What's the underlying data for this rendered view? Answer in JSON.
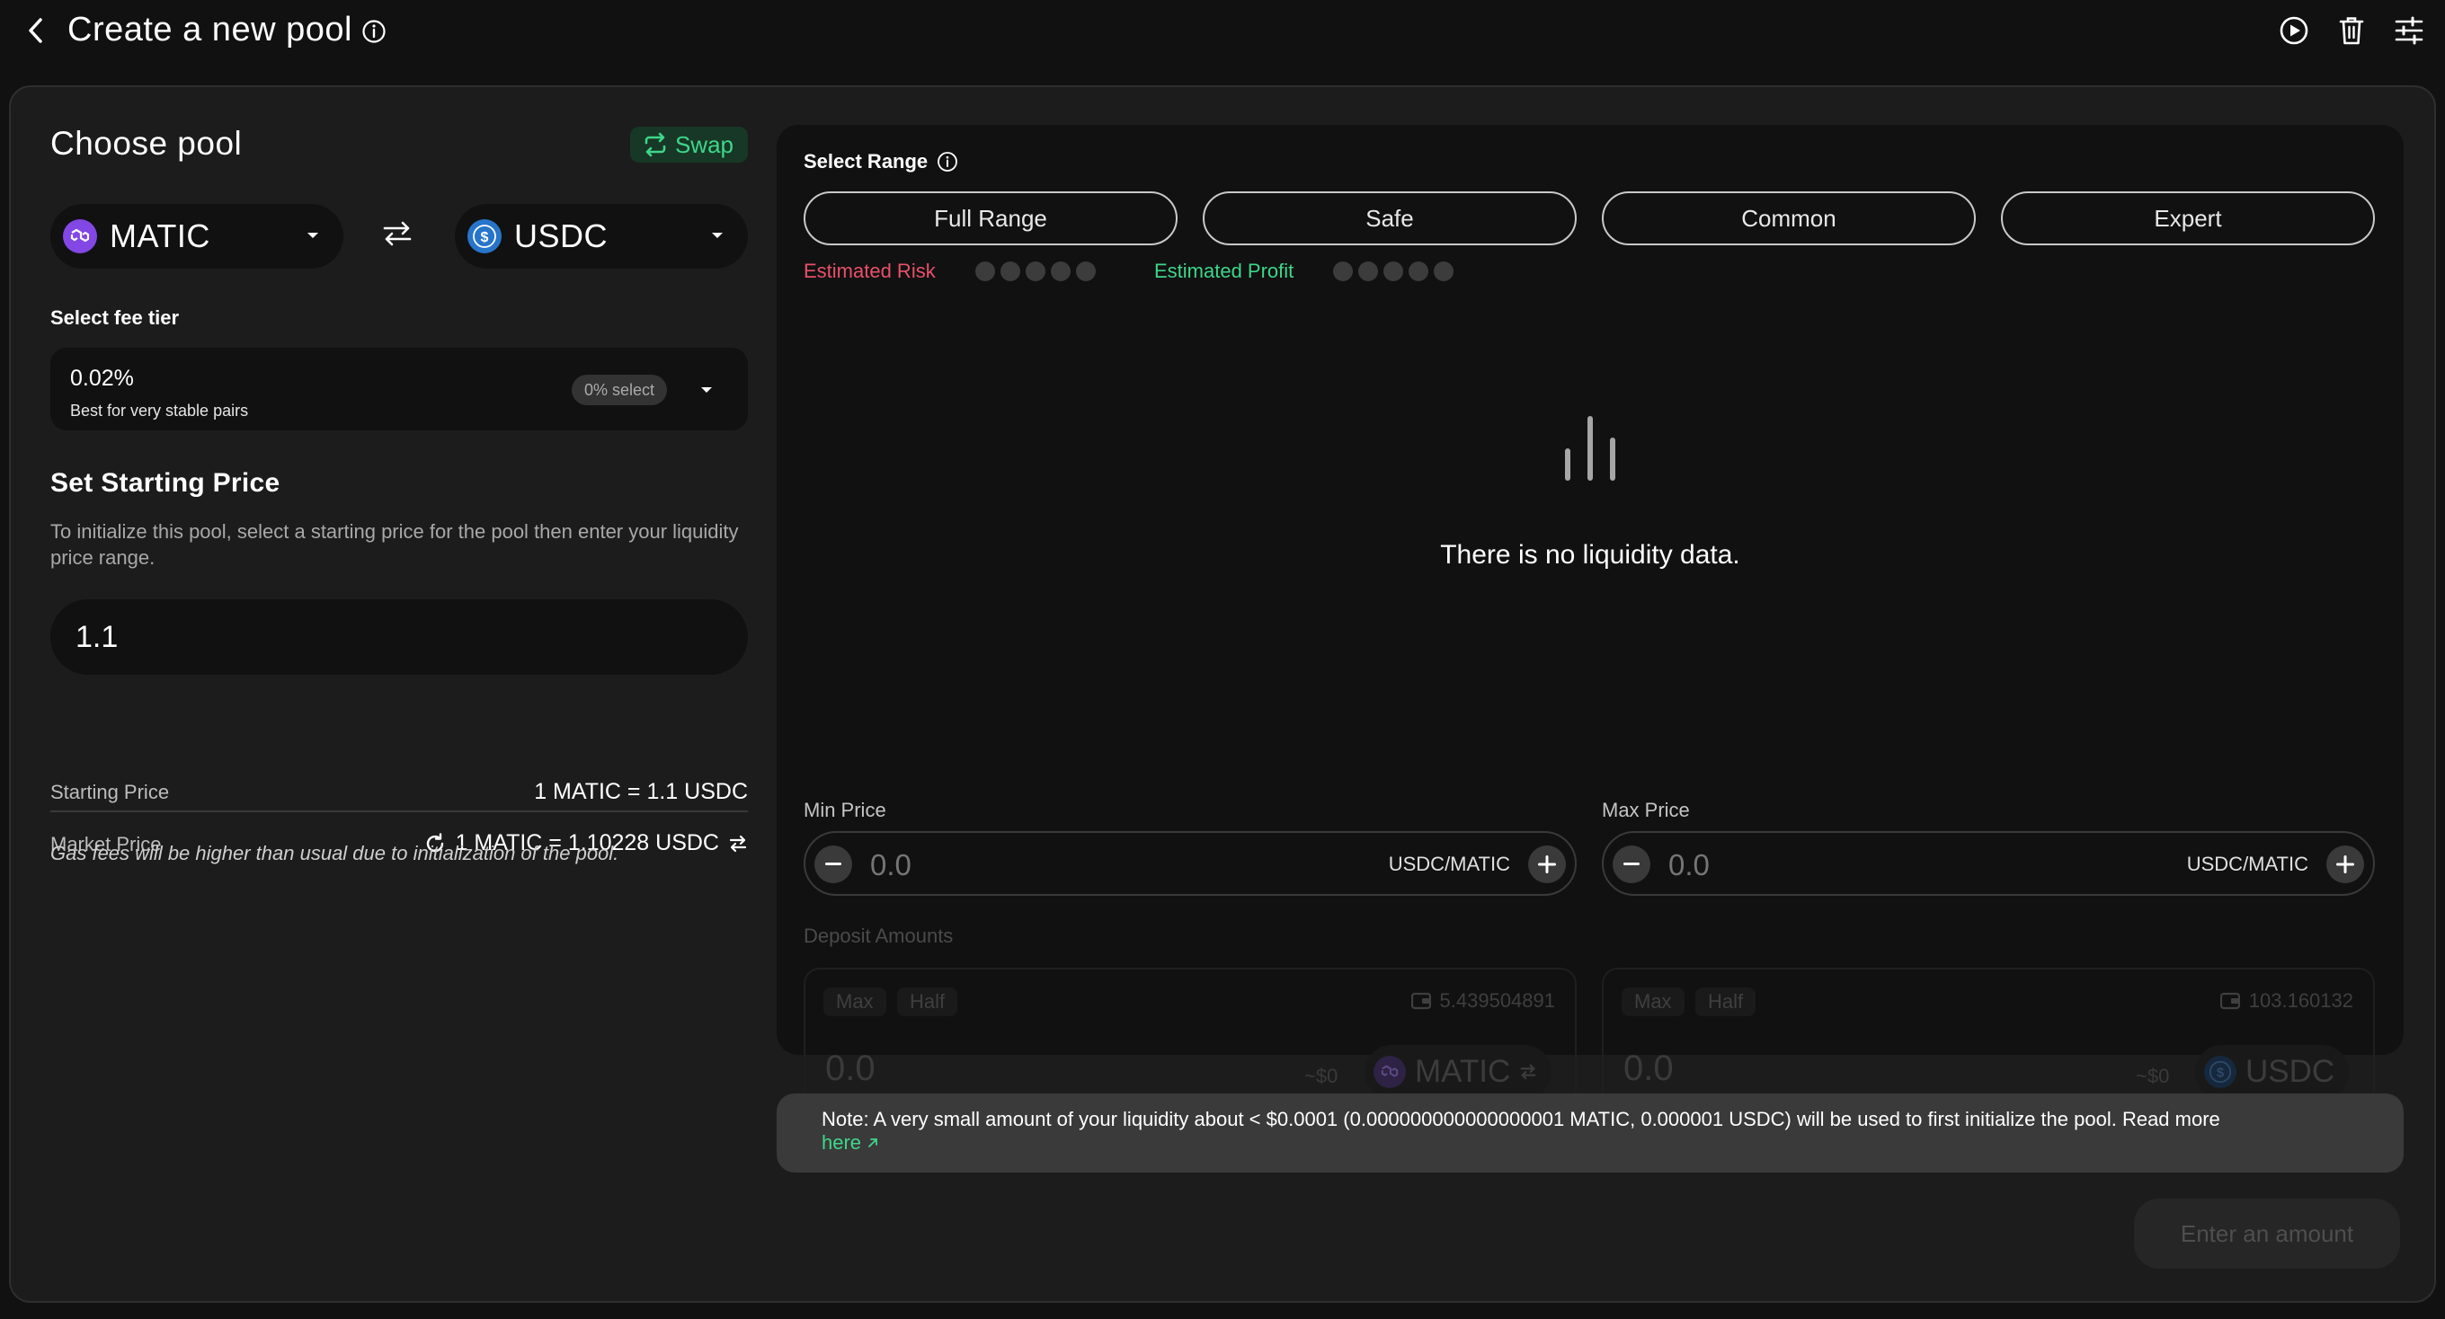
{
  "header": {
    "title": "Create a new pool"
  },
  "choose_pool": {
    "title": "Choose pool",
    "swap_label": "Swap",
    "token_a": "MATIC",
    "token_b": "USDC"
  },
  "fee_tier": {
    "label": "Select fee tier",
    "value": "0.02%",
    "description": "Best for very stable pairs",
    "badge": "0% select"
  },
  "starting_price": {
    "title": "Set Starting Price",
    "description": "To initialize this pool, select a starting price for the pool then enter your liquidity price range.",
    "input_value": "1.1",
    "starting_label": "Starting Price",
    "starting_value": "1 MATIC = 1.1 USDC",
    "market_label": "Market Price",
    "market_value": "1 MATIC = 1.10228 USDC",
    "gas_note": "Gas fees will be higher than usual due to initialization of the pool."
  },
  "range": {
    "label": "Select Range",
    "buttons": [
      "Full Range",
      "Safe",
      "Common",
      "Expert"
    ],
    "risk_label": "Estimated Risk",
    "profit_label": "Estimated Profit",
    "empty_text": "There is no liquidity data.",
    "min_label": "Min Price",
    "max_label": "Max Price",
    "min_value": "0.0",
    "max_value": "0.0",
    "unit": "USDC/MATIC"
  },
  "deposit": {
    "label": "Deposit Amounts",
    "max_label": "Max",
    "half_label": "Half",
    "a": {
      "balance": "5.439504891",
      "amount": "0.0",
      "usd": "~$0",
      "token": "MATIC"
    },
    "b": {
      "balance": "103.160132",
      "amount": "0.0",
      "usd": "~$0",
      "token": "USDC"
    }
  },
  "note": {
    "text": "Note: A very small amount of your liquidity about < $0.0001 (0.000000000000000001 MATIC, 0.000001 USDC) will be used to first initialize the pool. Read more",
    "link": "here"
  },
  "action": {
    "enter_amount": "Enter an amount"
  },
  "colors": {
    "background": "#111111",
    "card": "#1c1c1c",
    "accent_green": "#3ed68a",
    "risk_red": "#e8506a",
    "matic": "#8247e5",
    "usdc": "#2775ca"
  }
}
